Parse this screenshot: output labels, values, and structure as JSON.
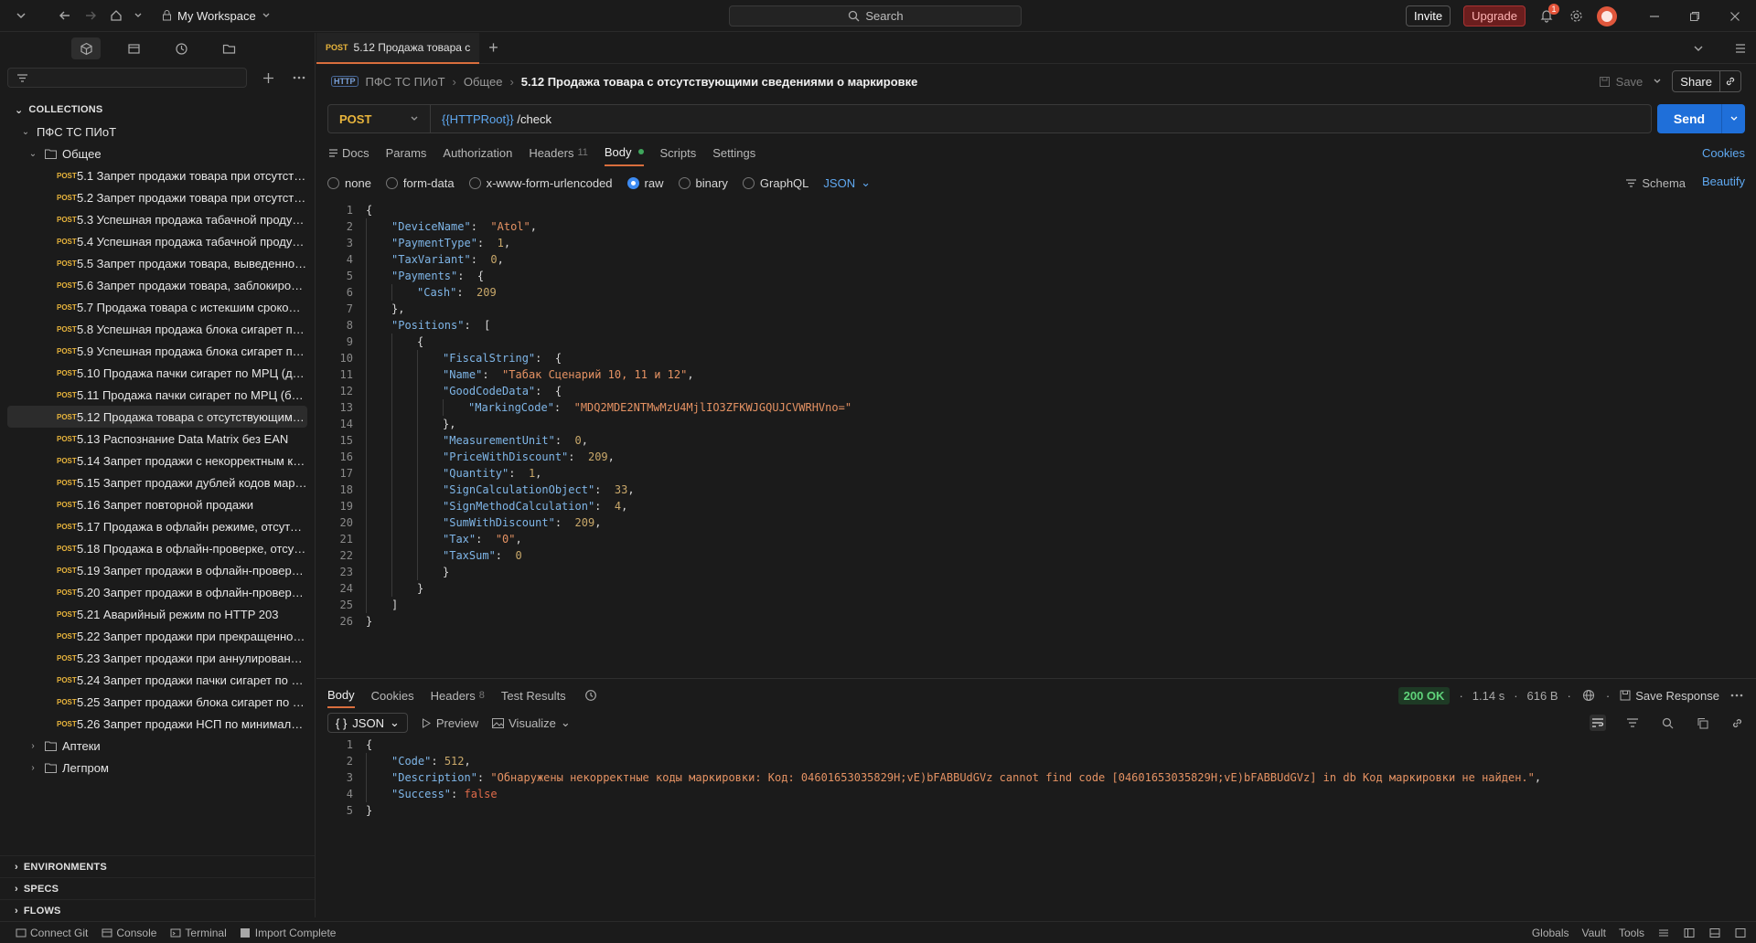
{
  "topbar": {
    "workspace": "My Workspace",
    "search_placeholder": "Search",
    "invite": "Invite",
    "upgrade": "Upgrade",
    "notifications_count": "1"
  },
  "sidebar": {
    "collections_header": "COLLECTIONS",
    "collection_name": "ПФС ТС ПИоТ",
    "folder_name": "Общее",
    "items": [
      {
        "method": "POST",
        "name": "5.1 Запрет продажи товара при отсутстви..."
      },
      {
        "method": "POST",
        "name": "5.2 Запрет продажи товара при отсутств..."
      },
      {
        "method": "POST",
        "name": "5.3 Успешная продажа табачной продукц..."
      },
      {
        "method": "POST",
        "name": "5.4 Успешная продажа табачной продукц..."
      },
      {
        "method": "POST",
        "name": "5.5 Запрет продажи товара, выведенного..."
      },
      {
        "method": "POST",
        "name": "5.6 Запрет продажи товара, заблокирова..."
      },
      {
        "method": "POST",
        "name": "5.7 Продажа товара с истекшим сроком г..."
      },
      {
        "method": "POST",
        "name": "5.8 Успешная продажа блока сигарет по ..."
      },
      {
        "method": "POST",
        "name": "5.9 Успешная продажа блока сигарет по ..."
      },
      {
        "method": "POST",
        "name": "5.10 Продажа пачки сигарет по МРЦ (до 1..."
      },
      {
        "method": "POST",
        "name": "5.11 Продажа пачки сигарет по МРЦ (бол..."
      },
      {
        "method": "POST",
        "name": "5.12 Продажа товара с отсутствующими ..."
      },
      {
        "method": "POST",
        "name": "5.13 Распознание Data Matrix без EAN"
      },
      {
        "method": "POST",
        "name": "5.14 Запрет продажи с некорректным ко..."
      },
      {
        "method": "POST",
        "name": "5.15 Запрет продажи дублей кодов марки..."
      },
      {
        "method": "POST",
        "name": "5.16 Запрет повторной продажи"
      },
      {
        "method": "POST",
        "name": "5.17 Продажа в офлайн режиме, отсутств..."
      },
      {
        "method": "POST",
        "name": "5.18 Продажа в офлайн-проверке, отсутс..."
      },
      {
        "method": "POST",
        "name": "5.19 Запрет продажи в офлайн-проверке,..."
      },
      {
        "method": "POST",
        "name": "5.20 Запрет продажи в офлайн-проверке ..."
      },
      {
        "method": "POST",
        "name": "5.21 Аварийный режим по HTTP 203"
      },
      {
        "method": "POST",
        "name": "5.22 Запрет продажи при прекращенном..."
      },
      {
        "method": "POST",
        "name": "5.23 Запрет продажи при аннулированно..."
      },
      {
        "method": "POST",
        "name": "5.24 Запрет продажи пачки сигарет по м..."
      },
      {
        "method": "POST",
        "name": "5.25 Запрет продажи блока сигарет по м..."
      },
      {
        "method": "POST",
        "name": "5.26 Запрет продажи НСП по минимальн..."
      }
    ],
    "other_folders": [
      "Аптеки",
      "Легпром"
    ],
    "bottom_sections": [
      "ENVIRONMENTS",
      "SPECS",
      "FLOWS"
    ]
  },
  "tab": {
    "method": "POST",
    "title": "5.12 Продажа товара с"
  },
  "breadcrumb": {
    "collection": "ПФС ТС ПИоТ",
    "folder": "Общее",
    "current": "5.12 Продажа товара с отсутствующими сведениями о маркировке",
    "save": "Save",
    "share": "Share"
  },
  "request": {
    "method": "POST",
    "url_var": "{{HTTPRoot}}",
    "url_path": " /check",
    "send": "Send"
  },
  "req_tabs": {
    "docs": "Docs",
    "params": "Params",
    "authorization": "Authorization",
    "headers": "Headers",
    "headers_count": "11",
    "body": "Body",
    "scripts": "Scripts",
    "settings": "Settings",
    "cookies": "Cookies"
  },
  "body_types": {
    "none": "none",
    "form_data": "form-data",
    "urlencoded": "x-www-form-urlencoded",
    "raw": "raw",
    "binary": "binary",
    "graphql": "GraphQL",
    "lang": "JSON",
    "schema": "Schema",
    "beautify": "Beautify"
  },
  "request_body": {
    "device_name_key": "\"DeviceName\"",
    "device_name_val": "\"Atol\"",
    "payment_type_key": "\"PaymentType\"",
    "payment_type_val": "1",
    "tax_variant_key": "\"TaxVariant\"",
    "tax_variant_val": "0",
    "payments_key": "\"Payments\"",
    "cash_key": "\"Cash\"",
    "cash_val": "209",
    "positions_key": "\"Positions\"",
    "fiscal_key": "\"FiscalString\"",
    "name_key": "\"Name\"",
    "name_val": "\"Табак Сценарий 10, 11 и 12\"",
    "goodcode_key": "\"GoodCodeData\"",
    "marking_key": "\"MarkingCode\"",
    "marking_val": "\"MDQ2MDE2NTMwMzU4MjlIO3ZFKWJGQUJCVWRHVno=\"",
    "unit_key": "\"MeasurementUnit\"",
    "unit_val": "0",
    "pwd_key": "\"PriceWithDiscount\"",
    "pwd_val": "209",
    "qty_key": "\"Quantity\"",
    "qty_val": "1",
    "sco_key": "\"SignCalculationObject\"",
    "sco_val": "33",
    "smc_key": "\"SignMethodCalculation\"",
    "smc_val": "4",
    "swd_key": "\"SumWithDiscount\"",
    "swd_val": "209",
    "tax_key": "\"Tax\"",
    "tax_val": "\"0\"",
    "taxsum_key": "\"TaxSum\"",
    "taxsum_val": "0"
  },
  "response": {
    "tabs": {
      "body": "Body",
      "cookies": "Cookies",
      "headers": "Headers",
      "headers_count": "8",
      "test_results": "Test Results"
    },
    "status": "200 OK",
    "time": "1.14 s",
    "size": "616 B",
    "save_response": "Save Response",
    "format": "JSON",
    "preview": "Preview",
    "visualize": "Visualize",
    "code_key": "\"Code\"",
    "code_val": "512",
    "desc_key": "\"Description\"",
    "desc_val": "\"Обнаружены некорректные коды маркировки: Код: 04601653035829H;vE)bFABBUdGVz cannot find code [04601653035829H;vE)bFABBUdGVz] in db Код маркировки не найден.\"",
    "success_key": "\"Success\"",
    "success_val": "false"
  },
  "statusbar": {
    "connect_git": "Connect Git",
    "console": "Console",
    "terminal": "Terminal",
    "import": "Import Complete",
    "globals": "Globals",
    "vault": "Vault",
    "tools": "Tools"
  }
}
